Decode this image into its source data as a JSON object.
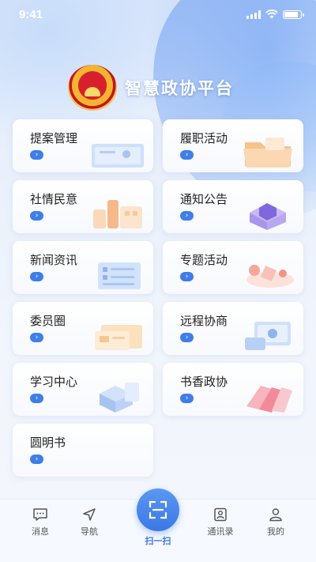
{
  "status_bar": {
    "time": "9:41",
    "battery_level": 0.85,
    "signal_bars": 4
  },
  "header": {
    "title": "智慧政协平台"
  },
  "colors": {
    "accent": "#3f7ee8",
    "text": "#1f1f1f",
    "tab_active": "#3b78e6"
  },
  "cards": [
    {
      "label": "提案管理",
      "icon": "document-card-illustration"
    },
    {
      "label": "履职活动",
      "icon": "folder-illustration"
    },
    {
      "label": "社情民意",
      "icon": "buildings-illustration"
    },
    {
      "label": "通知公告",
      "icon": "box-illustration"
    },
    {
      "label": "新闻资讯",
      "icon": "news-board-illustration"
    },
    {
      "label": "专题活动",
      "icon": "activity-illustration"
    },
    {
      "label": "委员圈",
      "icon": "circle-document-illustration"
    },
    {
      "label": "远程协商",
      "icon": "screen-illustration"
    },
    {
      "label": "学习中心",
      "icon": "cube-illustration"
    },
    {
      "label": "书香政协",
      "icon": "books-illustration"
    },
    {
      "label": "圆明书",
      "icon": ""
    }
  ],
  "tabbar": {
    "items": [
      {
        "label": "消息",
        "icon": "message-icon"
      },
      {
        "label": "导航",
        "icon": "navigation-icon"
      },
      {
        "label": "扫一扫",
        "icon": "scan-icon"
      },
      {
        "label": "通讯录",
        "icon": "contacts-icon"
      },
      {
        "label": "我的",
        "icon": "user-icon"
      }
    ]
  }
}
